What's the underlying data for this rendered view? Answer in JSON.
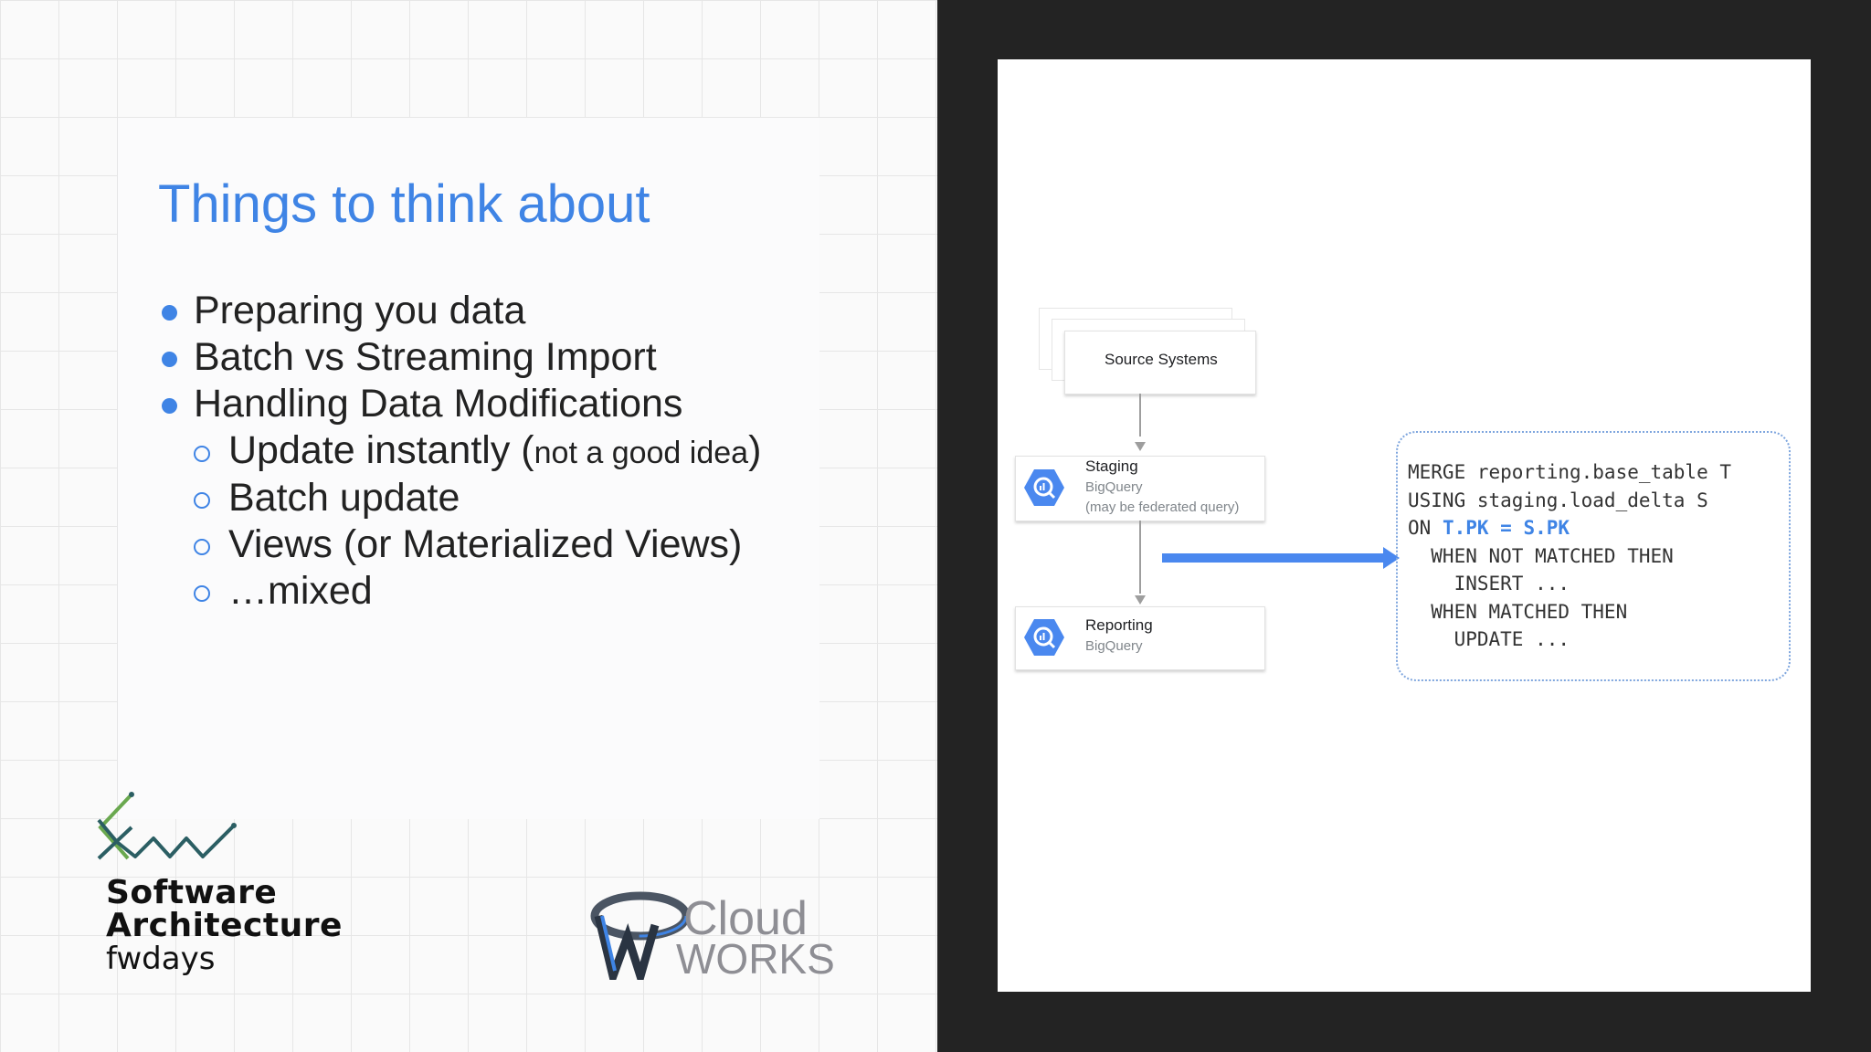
{
  "slide": {
    "title": "Things to think about",
    "bullets": [
      {
        "text": "Preparing you data"
      },
      {
        "text": "Batch vs Streaming Import"
      },
      {
        "text": "Handling Data Modifications"
      }
    ],
    "sub_bullets": [
      {
        "text": "Update instantly (",
        "small": "not a good idea",
        "tail": ")"
      },
      {
        "text": "Batch update"
      },
      {
        "text": "Views (or Materialized Views)"
      },
      {
        "text": "…mixed"
      }
    ]
  },
  "branding": {
    "conference_line1": "Software",
    "conference_line2": "Architecture",
    "conference_line3": "fwdays",
    "sponsor_line1": "Cloud",
    "sponsor_line2": "WORKS"
  },
  "diagram": {
    "source": {
      "label": "Source Systems"
    },
    "staging": {
      "label": "Staging",
      "sub1": "BigQuery",
      "sub2": "(may be federated query)",
      "icon": "bigquery-icon"
    },
    "reporting": {
      "label": "Reporting",
      "sub1": "BigQuery",
      "icon": "bigquery-icon"
    },
    "code_lines": {
      "l1": "MERGE reporting.base_table T",
      "l2": "USING staging.load_delta S",
      "l3_pre": "ON ",
      "l3_hl": "T.PK = S.PK",
      "l4": "  WHEN NOT MATCHED THEN",
      "l5": "    INSERT ...",
      "l6": "  WHEN MATCHED THEN",
      "l7": "    UPDATE ..."
    }
  },
  "colors": {
    "accent_blue": "#3f84e5",
    "dark_frame": "#232323",
    "fw_green": "#6aa84f",
    "fw_teal": "#2b5e63"
  }
}
